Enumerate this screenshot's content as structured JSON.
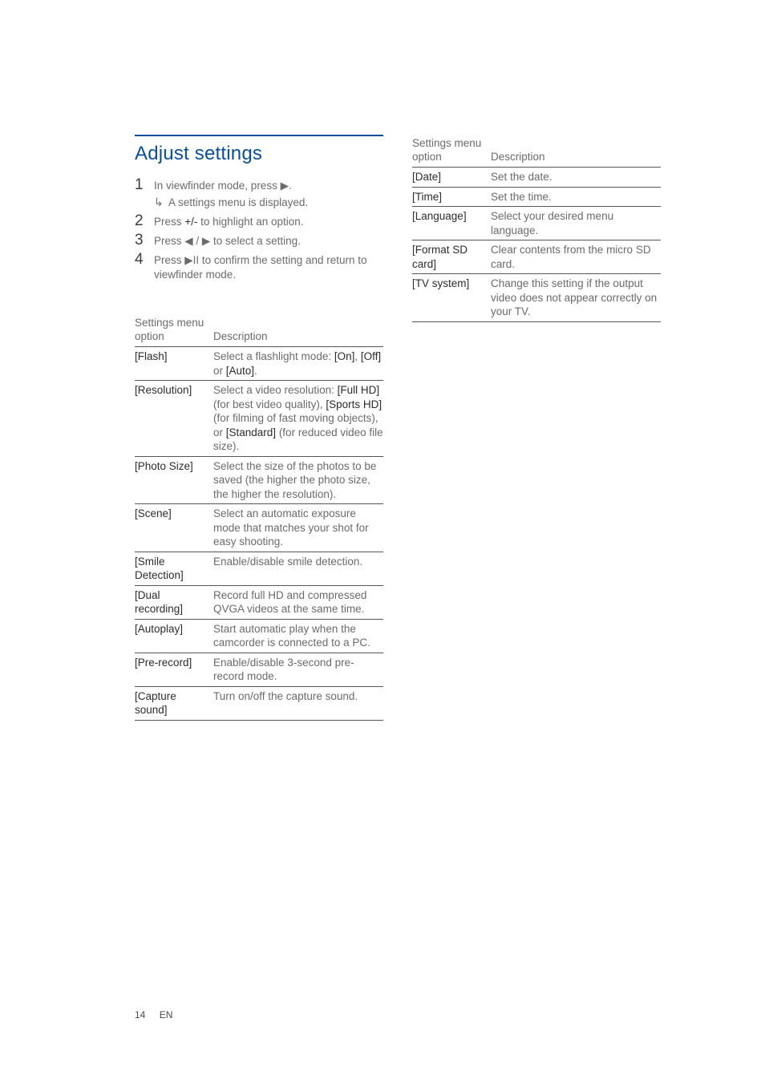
{
  "section_title": "Adjust settings",
  "steps": [
    {
      "num": "1",
      "text_before": "In viewfinder mode, press ",
      "glyph": "▶",
      "text_after": ".",
      "sub": {
        "arrow": "↳",
        "text": "A settings menu is displayed."
      }
    },
    {
      "num": "2",
      "text_before": "Press ",
      "bold": "+/-",
      "text_after": " to highlight an option."
    },
    {
      "num": "3",
      "text_before": "Press ",
      "glyph": "◀ / ▶",
      "text_after": " to select a setting."
    },
    {
      "num": "4",
      "text_before": "Press ",
      "glyph": "▶II",
      "text_after": " to confirm the setting and return to viewfinder mode."
    }
  ],
  "table1": {
    "head_left": "Settings menu option",
    "head_right": "Description",
    "rows": [
      {
        "label": "[Flash]",
        "desc_parts": [
          "Select a flashlight mode: ",
          {
            "b": "[On]"
          },
          ", ",
          {
            "b": "[Off]"
          },
          " or ",
          {
            "b": "[Auto]"
          },
          "."
        ]
      },
      {
        "label": "[Resolution]",
        "desc_parts": [
          "Select a video resolution: ",
          {
            "b": "[Full HD]"
          },
          " (for best video quality), ",
          {
            "b": "[Sports HD]"
          },
          " (for filming of fast moving objects), or ",
          {
            "b": "[Standard]"
          },
          " (for reduced video file size)."
        ]
      },
      {
        "label": "[Photo Size]",
        "desc_parts": [
          "Select the size of the photos to be saved (the higher the photo size, the higher the resolution)."
        ]
      },
      {
        "label": "[Scene]",
        "desc_parts": [
          "Select an automatic exposure mode that matches your shot for easy shooting."
        ]
      },
      {
        "label": "[Smile Detection]",
        "desc_parts": [
          "Enable/disable smile detection."
        ]
      },
      {
        "label": "[Dual recording]",
        "desc_parts": [
          "Record full HD and compressed QVGA videos at the same time."
        ]
      },
      {
        "label": "[Autoplay]",
        "desc_parts": [
          "Start automatic play when the camcorder is connected to a PC."
        ]
      },
      {
        "label": "[Pre-record]",
        "desc_parts": [
          "Enable/disable 3-second pre-record mode."
        ]
      },
      {
        "label": "[Capture sound]",
        "desc_parts": [
          "Turn on/off the capture sound."
        ]
      }
    ]
  },
  "table2": {
    "head_left": "Settings menu option",
    "head_right": "Description",
    "rows": [
      {
        "label": "[Date]",
        "desc_parts": [
          "Set the date."
        ]
      },
      {
        "label": "[Time]",
        "desc_parts": [
          "Set the time."
        ]
      },
      {
        "label": "[Language]",
        "desc_parts": [
          "Select your desired menu language."
        ]
      },
      {
        "label": "[Format SD card]",
        "desc_parts": [
          "Clear contents from the micro SD card."
        ]
      },
      {
        "label": "[TV system]",
        "desc_parts": [
          "Change this setting if the output video does not appear correctly on your TV."
        ]
      }
    ]
  },
  "footer": {
    "page": "14",
    "lang": "EN"
  }
}
